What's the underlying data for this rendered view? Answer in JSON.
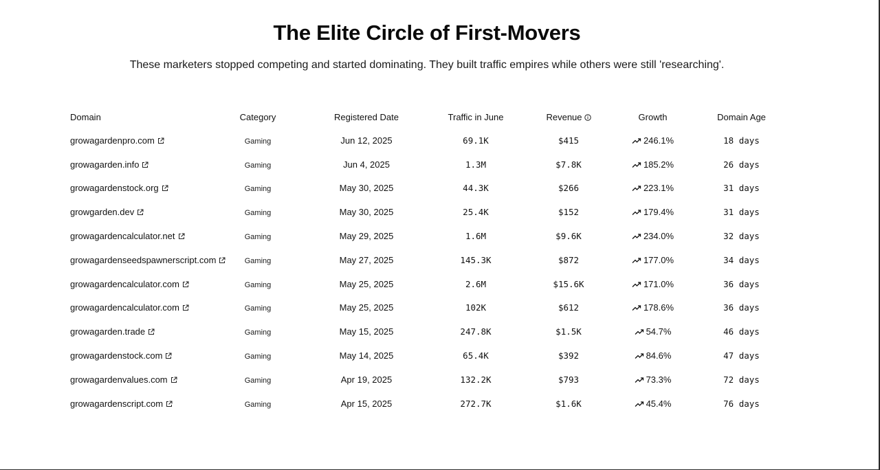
{
  "header": {
    "title": "The Elite Circle of First-Movers",
    "subtitle": "These marketers stopped competing and started dominating. They built traffic empires while others were still 'researching'."
  },
  "table": {
    "columns": {
      "domain": "Domain",
      "category": "Category",
      "registered": "Registered Date",
      "traffic": "Traffic in June",
      "revenue": "Revenue",
      "growth": "Growth",
      "age": "Domain Age"
    },
    "rows": [
      {
        "domain": "growagardenpro.com",
        "category": "Gaming",
        "registered": "Jun 12, 2025",
        "traffic": "69.1K",
        "revenue": "$415",
        "growth": "246.1%",
        "age": "18 days"
      },
      {
        "domain": "growagarden.info",
        "category": "Gaming",
        "registered": "Jun 4, 2025",
        "traffic": "1.3M",
        "revenue": "$7.8K",
        "growth": "185.2%",
        "age": "26 days"
      },
      {
        "domain": "growagardenstock.org",
        "category": "Gaming",
        "registered": "May 30, 2025",
        "traffic": "44.3K",
        "revenue": "$266",
        "growth": "223.1%",
        "age": "31 days"
      },
      {
        "domain": "growgarden.dev",
        "category": "Gaming",
        "registered": "May 30, 2025",
        "traffic": "25.4K",
        "revenue": "$152",
        "growth": "179.4%",
        "age": "31 days"
      },
      {
        "domain": "growagardencalculator.net",
        "category": "Gaming",
        "registered": "May 29, 2025",
        "traffic": "1.6M",
        "revenue": "$9.6K",
        "growth": "234.0%",
        "age": "32 days"
      },
      {
        "domain": "growagardenseedspawnerscript.com",
        "category": "Gaming",
        "registered": "May 27, 2025",
        "traffic": "145.3K",
        "revenue": "$872",
        "growth": "177.0%",
        "age": "34 days"
      },
      {
        "domain": "growagardencalculator.com",
        "category": "Gaming",
        "registered": "May 25, 2025",
        "traffic": "2.6M",
        "revenue": "$15.6K",
        "growth": "171.0%",
        "age": "36 days"
      },
      {
        "domain": "growagardencalculator.com",
        "category": "Gaming",
        "registered": "May 25, 2025",
        "traffic": "102K",
        "revenue": "$612",
        "growth": "178.6%",
        "age": "36 days"
      },
      {
        "domain": "growagarden.trade",
        "category": "Gaming",
        "registered": "May 15, 2025",
        "traffic": "247.8K",
        "revenue": "$1.5K",
        "growth": "54.7%",
        "age": "46 days"
      },
      {
        "domain": "growagardenstock.com",
        "category": "Gaming",
        "registered": "May 14, 2025",
        "traffic": "65.4K",
        "revenue": "$392",
        "growth": "84.6%",
        "age": "47 days"
      },
      {
        "domain": "growagardenvalues.com",
        "category": "Gaming",
        "registered": "Apr 19, 2025",
        "traffic": "132.2K",
        "revenue": "$793",
        "growth": "73.3%",
        "age": "72 days"
      },
      {
        "domain": "growagardenscript.com",
        "category": "Gaming",
        "registered": "Apr 15, 2025",
        "traffic": "272.7K",
        "revenue": "$1.6K",
        "growth": "45.4%",
        "age": "76 days"
      }
    ]
  },
  "icons": {
    "external": "external-link-icon",
    "trend": "trending-up-icon",
    "info": "info-icon"
  }
}
